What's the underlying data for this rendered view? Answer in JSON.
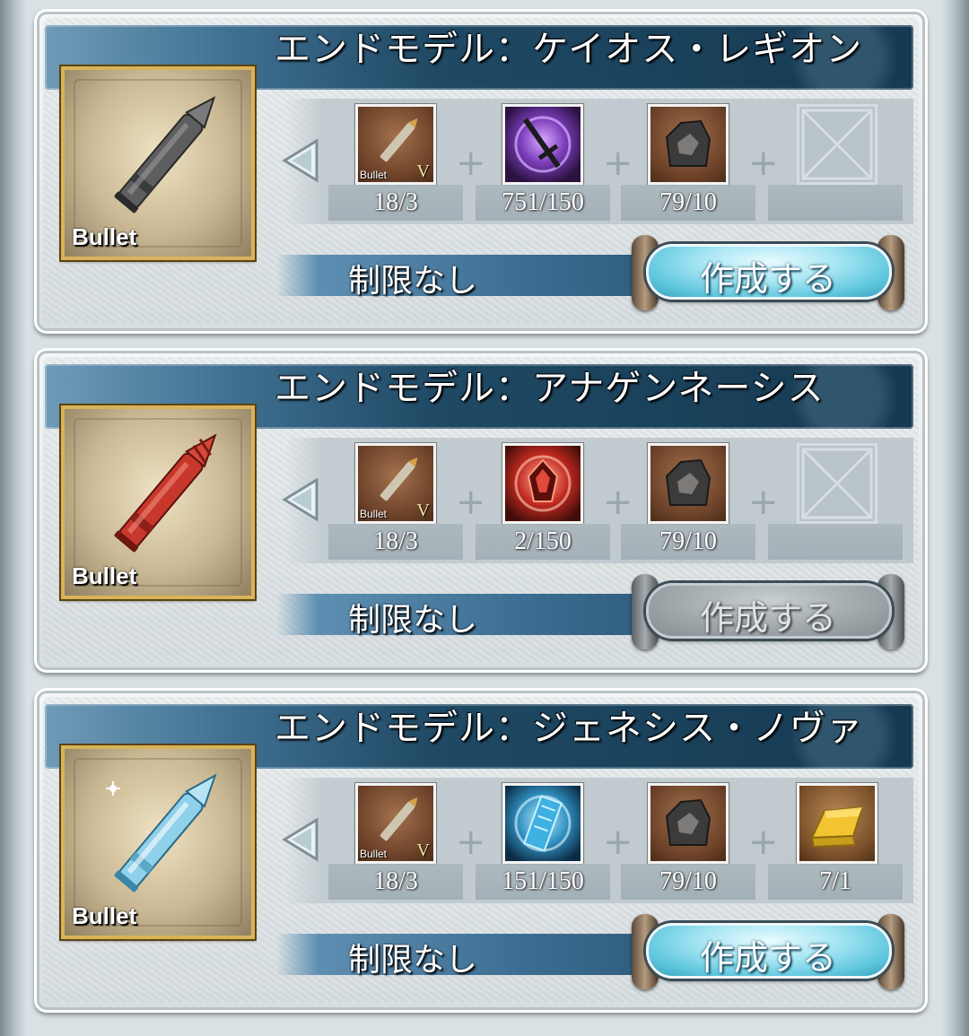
{
  "recipes": [
    {
      "title": "エンドモデル：ケイオス・レギオン",
      "thumb_label": "Bullet",
      "thumb_color": "#6b6b6b",
      "materials": [
        {
          "name": "bullet-v-icon",
          "count": "18/3",
          "mini": "Bullet",
          "rank": "V"
        },
        {
          "name": "dark-sword-orb-icon",
          "count": "751/150"
        },
        {
          "name": "ore-chunk-icon",
          "count": "79/10"
        },
        {
          "name": "empty-slot-icon",
          "count": ""
        }
      ],
      "limit": "制限なし",
      "button": "作成する",
      "enabled": true
    },
    {
      "title": "エンドモデル：アナゲンネーシス",
      "thumb_label": "Bullet",
      "thumb_color": "#c63a2e",
      "materials": [
        {
          "name": "bullet-v-icon",
          "count": "18/3",
          "mini": "Bullet",
          "rank": "V"
        },
        {
          "name": "fire-crest-orb-icon",
          "count": "2/150"
        },
        {
          "name": "ore-chunk-icon",
          "count": "79/10"
        },
        {
          "name": "empty-slot-icon",
          "count": ""
        }
      ],
      "limit": "制限なし",
      "button": "作成する",
      "enabled": false
    },
    {
      "title": "エンドモデル：ジェネシス・ノヴァ",
      "thumb_label": "Bullet",
      "thumb_color": "#8fd0ea",
      "materials": [
        {
          "name": "bullet-v-icon",
          "count": "18/3",
          "mini": "Bullet",
          "rank": "V"
        },
        {
          "name": "ice-tablet-orb-icon",
          "count": "151/150"
        },
        {
          "name": "ore-chunk-icon",
          "count": "79/10"
        },
        {
          "name": "gold-bar-icon",
          "count": "7/1"
        }
      ],
      "limit": "制限なし",
      "button": "作成する",
      "enabled": true
    }
  ]
}
